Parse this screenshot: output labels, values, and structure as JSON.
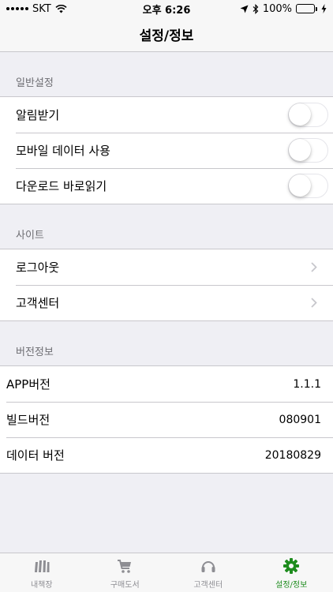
{
  "status_bar": {
    "carrier": "SKT",
    "time": "오후 6:26",
    "battery_percent": "100%",
    "battery_level": 1.0
  },
  "nav": {
    "title": "설정/정보"
  },
  "sections": {
    "general": {
      "header": "일반설정",
      "rows": [
        {
          "label": "알림받기",
          "toggle_on": false
        },
        {
          "label": "모바일 데이터 사용",
          "toggle_on": false
        },
        {
          "label": "다운로드 바로읽기",
          "toggle_on": false
        }
      ]
    },
    "site": {
      "header": "사이트",
      "rows": [
        {
          "label": "로그아웃"
        },
        {
          "label": "고객센터"
        }
      ]
    },
    "version": {
      "header": "버전정보",
      "rows": [
        {
          "label": "APP버전",
          "value": "1.1.1"
        },
        {
          "label": "빌드버전",
          "value": "080901"
        },
        {
          "label": "데이터 버전",
          "value": "20180829"
        }
      ]
    }
  },
  "tabs": [
    {
      "label": "내책장",
      "icon": "bookshelf-icon",
      "active": false
    },
    {
      "label": "구매도서",
      "icon": "cart-icon",
      "active": false
    },
    {
      "label": "고객센터",
      "icon": "headset-icon",
      "active": false
    },
    {
      "label": "설정/정보",
      "icon": "gear-icon",
      "active": true
    }
  ],
  "colors": {
    "accent": "#1e8c1e",
    "battery": "#4cd964",
    "tab_inactive": "#8e8e93",
    "background": "#efeff4"
  }
}
